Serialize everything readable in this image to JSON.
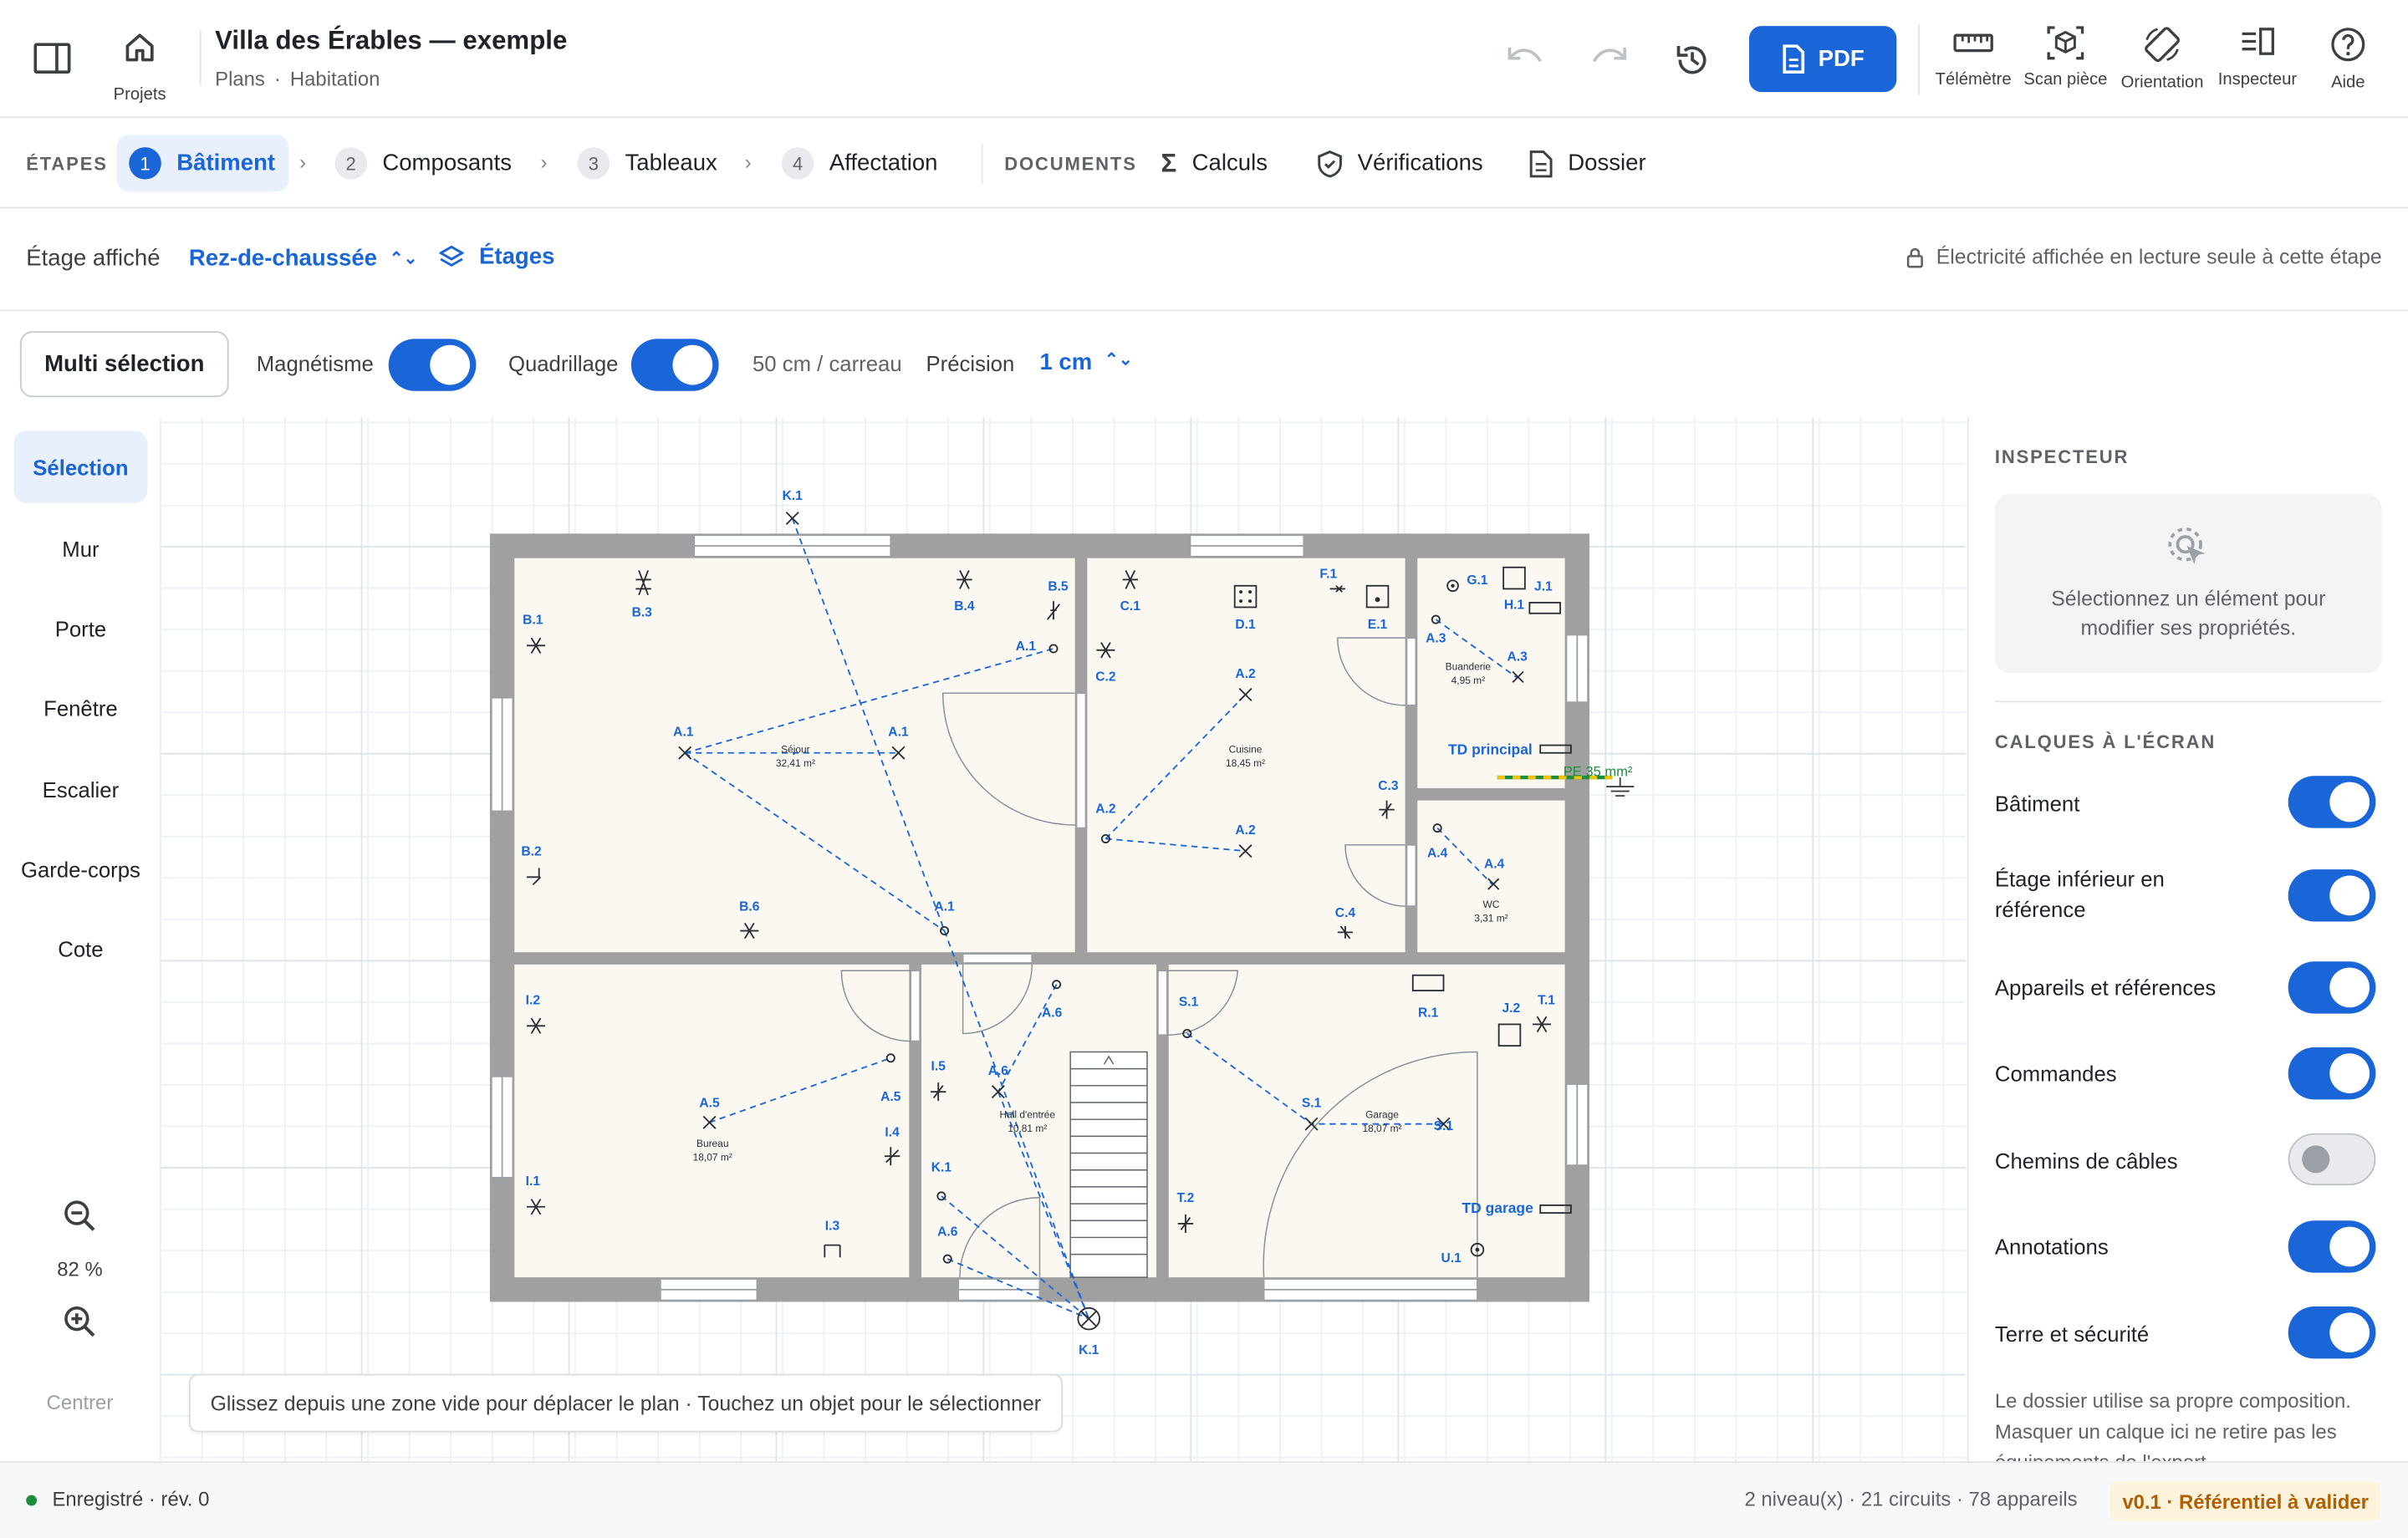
{
  "header": {
    "projects_label": "Projets",
    "title": "Villa des Érables — exemple",
    "breadcrumb": {
      "part1": "Plans",
      "separator": "·",
      "part2": "Habitation"
    },
    "pdf_label": "PDF",
    "tools": [
      {
        "label": "Télémètre",
        "icon": "ruler-icon"
      },
      {
        "label": "Scan pièce",
        "icon": "cube-scan-icon"
      },
      {
        "label": "Orientation",
        "icon": "rotate-device-icon"
      },
      {
        "label": "Inspecteur",
        "icon": "inspector-panel-icon"
      },
      {
        "label": "Aide",
        "icon": "help-icon"
      }
    ]
  },
  "steps": {
    "label": "ÉTAPES",
    "items": [
      {
        "num": "1",
        "label": "Bâtiment",
        "active": true
      },
      {
        "num": "2",
        "label": "Composants"
      },
      {
        "num": "3",
        "label": "Tableaux"
      },
      {
        "num": "4",
        "label": "Affectation"
      }
    ],
    "documents_label": "DOCUMENTS",
    "documents": [
      {
        "label": "Calculs",
        "icon": "sigma-icon"
      },
      {
        "label": "Vérifications",
        "icon": "shield-check-icon"
      },
      {
        "label": "Dossier",
        "icon": "document-icon"
      }
    ]
  },
  "floor": {
    "label": "Étage affiché",
    "value": "Rez-de-chaussée",
    "floors_label": "Étages",
    "readonly_notice": "Électricité affichée en lecture seule à cette étape"
  },
  "toolbar": {
    "multi_select": "Multi sélection",
    "magnetism_label": "Magnétisme",
    "magnetism_on": true,
    "grid_label": "Quadrillage",
    "grid_on": true,
    "grid_scale": "50 cm / carreau",
    "precision_label": "Précision",
    "precision_value": "1 cm"
  },
  "left_tools": [
    "Sélection",
    "Mur",
    "Porte",
    "Fenêtre",
    "Escalier",
    "Garde-corps",
    "Cote"
  ],
  "zoom": {
    "value": "82 %",
    "center_label": "Centrer"
  },
  "plan": {
    "hint": "Glissez depuis une zone vide pour déplacer le plan · Touchez un objet pour le sélectionner",
    "rooms": [
      {
        "name": "Séjour",
        "area": "32,41 m²"
      },
      {
        "name": "Cuisine",
        "area": "18,45 m²"
      },
      {
        "name": "Buanderie",
        "area": "4,95 m²"
      },
      {
        "name": "WC",
        "area": "3,31 m²"
      },
      {
        "name": "Bureau",
        "area": "18,07 m²"
      },
      {
        "name": "Hall d'entrée",
        "area": "10,81 m²"
      },
      {
        "name": "Garage",
        "area": "18,07 m²"
      }
    ],
    "labels": [
      "K.1",
      "B.1",
      "B.3",
      "B.4",
      "B.5",
      "A.1",
      "A.1",
      "A.1",
      "A.1",
      "C.1",
      "C.2",
      "D.1",
      "F.1",
      "E.1",
      "G.1",
      "H.1",
      "J.1",
      "A.3",
      "A.3",
      "A.2",
      "A.2",
      "A.2",
      "C.3",
      "A.4",
      "A.4",
      "C.4",
      "B.2",
      "B.6",
      "I.2",
      "A.5",
      "A.5",
      "I.4",
      "I.1",
      "I.3",
      "I.5",
      "A.6",
      "A.6",
      "A.6",
      "K.1",
      "K.1",
      "S.1",
      "S.1",
      "S.1",
      "R.1",
      "J.2",
      "T.1",
      "T.2",
      "U.1"
    ],
    "panels": {
      "main": "TD principal",
      "garage": "TD garage",
      "earth": "PE 35 mm²"
    }
  },
  "inspector": {
    "title": "INSPECTEUR",
    "empty_text": "Sélectionnez un élément pour modifier ses propriétés.",
    "layers_title": "CALQUES À L'ÉCRAN",
    "layers": [
      {
        "label": "Bâtiment",
        "on": true
      },
      {
        "label": "Étage inférieur en référence",
        "on": true
      },
      {
        "label": "Appareils et références",
        "on": true
      },
      {
        "label": "Commandes",
        "on": true
      },
      {
        "label": "Chemins de câbles",
        "on": false
      },
      {
        "label": "Annotations",
        "on": true
      },
      {
        "label": "Terre et sécurité",
        "on": true
      }
    ],
    "note": "Le dossier utilise sa propre composition. Masquer un calque ici ne retire pas les équipements de l'export."
  },
  "status": {
    "saved": "Enregistré · rév. 0",
    "summary": "2 niveau(x) · 21 circuits · 78 appareils",
    "version": "v0.1 · Référentiel à valider"
  },
  "colors": {
    "accent": "#1a66d9",
    "saved_dot": "#1e8e3e",
    "version_bg": "#fdf3dc",
    "version_text": "#b06000"
  }
}
